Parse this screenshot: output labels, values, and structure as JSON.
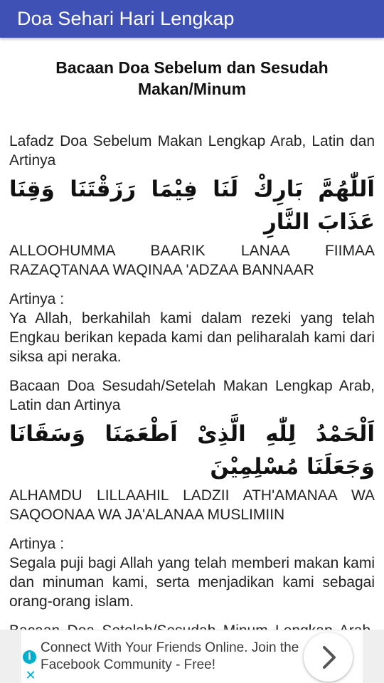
{
  "appbar": {
    "title": "Doa Sehari Hari Lengkap"
  },
  "page": {
    "title": "Bacaan Doa Sebelum dan Sesudah Makan/Minum",
    "sections": [
      {
        "heading": "Lafadz Doa Sebelum Makan Lengkap Arab, Latin dan Artinya",
        "arabic": "اَللّٰهُمَّ بَارِكْ لَنَا فِيْمَا رَزَقْتَنَا وَقِنَا عَذَابَ النَّارِ",
        "latin": "ALLOOHUMMA BAARIK LANAA FIIMAA RAZAQTANAA WAQINAA 'ADZAA BANNAAR",
        "translation_label": "Artinya :",
        "translation": "Ya Allah, berkahilah kami dalam rezeki yang telah Engkau berikan kepada kami dan peliharalah kami dari siksa api neraka."
      },
      {
        "heading": "Bacaan Doa Sesudah/Setelah Makan Lengkap Arab, Latin dan Artinya",
        "arabic": "اَلْحَمْدُ لِلّٰهِ الَّذِىْ اَطْعَمَنَا وَسَقَانَا وَجَعَلَنَا مُسْلِمِيْنَ",
        "latin": "ALHAMDU LILLAAHIL LADZII ATH'AMANAA WA SAQOONAA WA JA'ALANAA MUSLIMIIN",
        "translation_label": "Artinya :",
        "translation": "Segala puji bagi Allah yang telah memberi makan kami dan minuman kami, serta menjadikan kami sebagai orang-orang islam."
      },
      {
        "heading": "Bacaan Doa Setelah/Sesudah Minum Lengkap Arab, Latin dan Artinya"
      }
    ]
  },
  "ad": {
    "text": "Connect With Your Friends Online. Join the Facebook Community - Free!",
    "info_icon": "info-icon",
    "close_icon": "close-icon",
    "arrow_icon": "chevron-right-icon",
    "accent_color": "#00aecd"
  },
  "colors": {
    "appbar": "#3f51b5",
    "appbar_text": "#ffffff",
    "body_text": "#222222"
  }
}
